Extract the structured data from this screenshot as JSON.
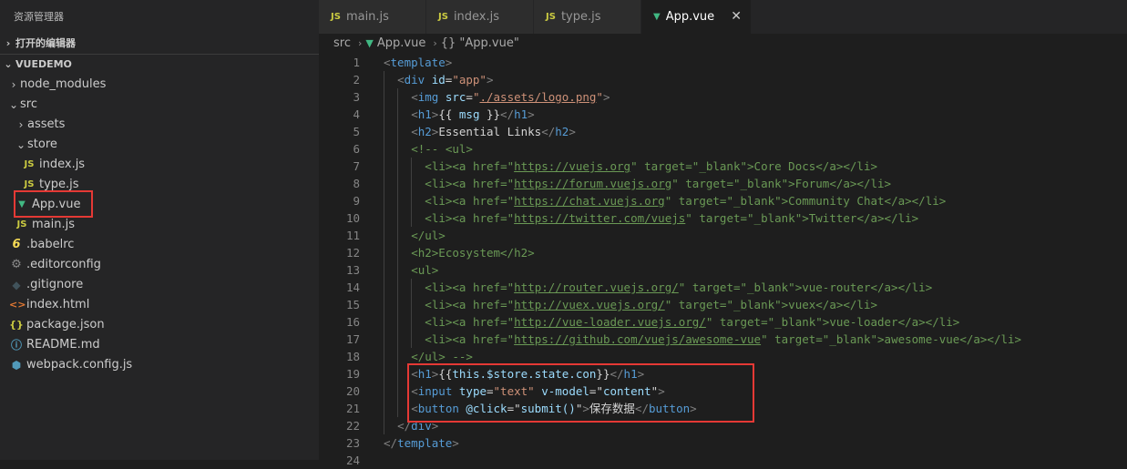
{
  "sidebar": {
    "title": "资源管理器",
    "open_editors": "打开的编辑器",
    "project": "VUEDEMO",
    "items": [
      {
        "label": "node_modules",
        "type": "folder",
        "depth": 0,
        "open": false
      },
      {
        "label": "src",
        "type": "folder",
        "depth": 0,
        "open": true
      },
      {
        "label": "assets",
        "type": "folder",
        "depth": 1,
        "open": false
      },
      {
        "label": "store",
        "type": "folder",
        "depth": 1,
        "open": true
      },
      {
        "label": "index.js",
        "type": "js",
        "depth": 2
      },
      {
        "label": "type.js",
        "type": "js",
        "depth": 2
      },
      {
        "label": "App.vue",
        "type": "vue",
        "depth": 1
      },
      {
        "label": "main.js",
        "type": "js",
        "depth": 1
      },
      {
        "label": ".babelrc",
        "type": "babel",
        "depth": 0
      },
      {
        "label": ".editorconfig",
        "type": "gear",
        "depth": 0
      },
      {
        "label": ".gitignore",
        "type": "git",
        "depth": 0
      },
      {
        "label": "index.html",
        "type": "html",
        "depth": 0
      },
      {
        "label": "package.json",
        "type": "json",
        "depth": 0
      },
      {
        "label": "README.md",
        "type": "info",
        "depth": 0
      },
      {
        "label": "webpack.config.js",
        "type": "webpack",
        "depth": 0
      }
    ]
  },
  "tabs": [
    {
      "label": "main.js",
      "type": "js",
      "active": false
    },
    {
      "label": "index.js",
      "type": "js",
      "active": false
    },
    {
      "label": "type.js",
      "type": "js",
      "active": false
    },
    {
      "label": "App.vue",
      "type": "vue",
      "active": true
    }
  ],
  "breadcrumb": {
    "folder": "src",
    "file": "App.vue",
    "symbol": "{} \"App.vue\""
  },
  "icons": {
    "js": "JS",
    "vue": "▼",
    "close": "✕",
    "chevron_right": "›",
    "chevron_down": "⌄"
  },
  "code_lines": [
    {
      "n": "1",
      "indent": 0,
      "tokens": [
        [
          "t",
          "<"
        ],
        [
          "g",
          "template"
        ],
        [
          "t",
          ">"
        ]
      ]
    },
    {
      "n": "2",
      "indent": 1,
      "tokens": [
        [
          "t",
          "<"
        ],
        [
          "g",
          "div"
        ],
        [
          "s",
          " "
        ],
        [
          "a",
          "id"
        ],
        [
          "x",
          "="
        ],
        [
          "v",
          "\"app\""
        ],
        [
          "t",
          ">"
        ]
      ]
    },
    {
      "n": "3",
      "indent": 2,
      "tokens": [
        [
          "t",
          "<"
        ],
        [
          "g",
          "img"
        ],
        [
          "s",
          " "
        ],
        [
          "a",
          "src"
        ],
        [
          "x",
          "="
        ],
        [
          "v",
          "\""
        ],
        [
          "l",
          "./assets/logo.png"
        ],
        [
          "v",
          "\""
        ],
        [
          "t",
          ">"
        ]
      ]
    },
    {
      "n": "4",
      "indent": 2,
      "tokens": [
        [
          "t",
          "<"
        ],
        [
          "g",
          "h1"
        ],
        [
          "t",
          ">"
        ],
        [
          "x",
          "{{ "
        ],
        [
          "a",
          "msg"
        ],
        [
          "x",
          " }}"
        ],
        [
          "t",
          "</"
        ],
        [
          "g",
          "h1"
        ],
        [
          "t",
          ">"
        ]
      ]
    },
    {
      "n": "5",
      "indent": 2,
      "tokens": [
        [
          "t",
          "<"
        ],
        [
          "g",
          "h2"
        ],
        [
          "t",
          ">"
        ],
        [
          "x",
          "Essential Links"
        ],
        [
          "t",
          "</"
        ],
        [
          "g",
          "h2"
        ],
        [
          "t",
          ">"
        ]
      ]
    },
    {
      "n": "6",
      "indent": 2,
      "tokens": [
        [
          "c",
          "<!-- <ul>"
        ]
      ]
    },
    {
      "n": "7",
      "indent": 3,
      "tokens": [
        [
          "c",
          "<li><a href=\""
        ],
        [
          "cl",
          "https://vuejs.org"
        ],
        [
          "c",
          "\" target=\"_blank\">Core Docs</a></li>"
        ]
      ]
    },
    {
      "n": "8",
      "indent": 3,
      "tokens": [
        [
          "c",
          "<li><a href=\""
        ],
        [
          "cl",
          "https://forum.vuejs.org"
        ],
        [
          "c",
          "\" target=\"_blank\">Forum</a></li>"
        ]
      ]
    },
    {
      "n": "9",
      "indent": 3,
      "tokens": [
        [
          "c",
          "<li><a href=\""
        ],
        [
          "cl",
          "https://chat.vuejs.org"
        ],
        [
          "c",
          "\" target=\"_blank\">Community Chat</a></li>"
        ]
      ]
    },
    {
      "n": "10",
      "indent": 3,
      "tokens": [
        [
          "c",
          "<li><a href=\""
        ],
        [
          "cl",
          "https://twitter.com/vuejs"
        ],
        [
          "c",
          "\" target=\"_blank\">Twitter</a></li>"
        ]
      ]
    },
    {
      "n": "11",
      "indent": 2,
      "tokens": [
        [
          "c",
          "</ul>"
        ]
      ]
    },
    {
      "n": "12",
      "indent": 2,
      "tokens": [
        [
          "c",
          "<h2>Ecosystem</h2>"
        ]
      ]
    },
    {
      "n": "13",
      "indent": 2,
      "tokens": [
        [
          "c",
          "<ul>"
        ]
      ]
    },
    {
      "n": "14",
      "indent": 3,
      "tokens": [
        [
          "c",
          "<li><a href=\""
        ],
        [
          "cl",
          "http://router.vuejs.org/"
        ],
        [
          "c",
          "\" target=\"_blank\">vue-router</a></li>"
        ]
      ]
    },
    {
      "n": "15",
      "indent": 3,
      "tokens": [
        [
          "c",
          "<li><a href=\""
        ],
        [
          "cl",
          "http://vuex.vuejs.org/"
        ],
        [
          "c",
          "\" target=\"_blank\">vuex</a></li>"
        ]
      ]
    },
    {
      "n": "16",
      "indent": 3,
      "tokens": [
        [
          "c",
          "<li><a href=\""
        ],
        [
          "cl",
          "http://vue-loader.vuejs.org/"
        ],
        [
          "c",
          "\" target=\"_blank\">vue-loader</a></li>"
        ]
      ]
    },
    {
      "n": "17",
      "indent": 3,
      "tokens": [
        [
          "c",
          "<li><a href=\""
        ],
        [
          "cl",
          "https://github.com/vuejs/awesome-vue"
        ],
        [
          "c",
          "\" target=\"_blank\">awesome-vue</a></li>"
        ]
      ]
    },
    {
      "n": "18",
      "indent": 2,
      "tokens": [
        [
          "c",
          "</ul> -->"
        ]
      ]
    },
    {
      "n": "19",
      "indent": 2,
      "tokens": [
        [
          "t",
          "<"
        ],
        [
          "g",
          "h1"
        ],
        [
          "t",
          ">"
        ],
        [
          "x",
          "{{"
        ],
        [
          "a",
          "this.$store.state.con"
        ],
        [
          "x",
          "}}"
        ],
        [
          "t",
          "</"
        ],
        [
          "g",
          "h1"
        ],
        [
          "t",
          ">"
        ]
      ]
    },
    {
      "n": "20",
      "indent": 2,
      "tokens": [
        [
          "t",
          "<"
        ],
        [
          "g",
          "input"
        ],
        [
          "s",
          " "
        ],
        [
          "a",
          "type"
        ],
        [
          "x",
          "="
        ],
        [
          "v",
          "\"text\""
        ],
        [
          "s",
          " "
        ],
        [
          "a",
          "v-model"
        ],
        [
          "x",
          "="
        ],
        [
          "x",
          "\""
        ],
        [
          "a",
          "content"
        ],
        [
          "x",
          "\""
        ],
        [
          "t",
          ">"
        ]
      ]
    },
    {
      "n": "21",
      "indent": 2,
      "tokens": [
        [
          "t",
          "<"
        ],
        [
          "g",
          "button"
        ],
        [
          "s",
          " "
        ],
        [
          "a",
          "@click"
        ],
        [
          "x",
          "="
        ],
        [
          "x",
          "\""
        ],
        [
          "a",
          "submit()"
        ],
        [
          "x",
          "\""
        ],
        [
          "t",
          ">"
        ],
        [
          "x",
          "保存数据"
        ],
        [
          "t",
          "</"
        ],
        [
          "g",
          "button"
        ],
        [
          "t",
          ">"
        ]
      ]
    },
    {
      "n": "22",
      "indent": 1,
      "tokens": [
        [
          "t",
          "</"
        ],
        [
          "g",
          "div"
        ],
        [
          "t",
          ">"
        ]
      ]
    },
    {
      "n": "23",
      "indent": 0,
      "tokens": [
        [
          "t",
          "</"
        ],
        [
          "g",
          "template"
        ],
        [
          "t",
          ">"
        ]
      ]
    },
    {
      "n": "24",
      "indent": 0,
      "tokens": []
    }
  ],
  "colors": {
    "highlight": "#e53935",
    "tag": "#569cd6",
    "attr": "#9cdcfe",
    "string": "#ce9178",
    "comment": "#6a9955"
  }
}
